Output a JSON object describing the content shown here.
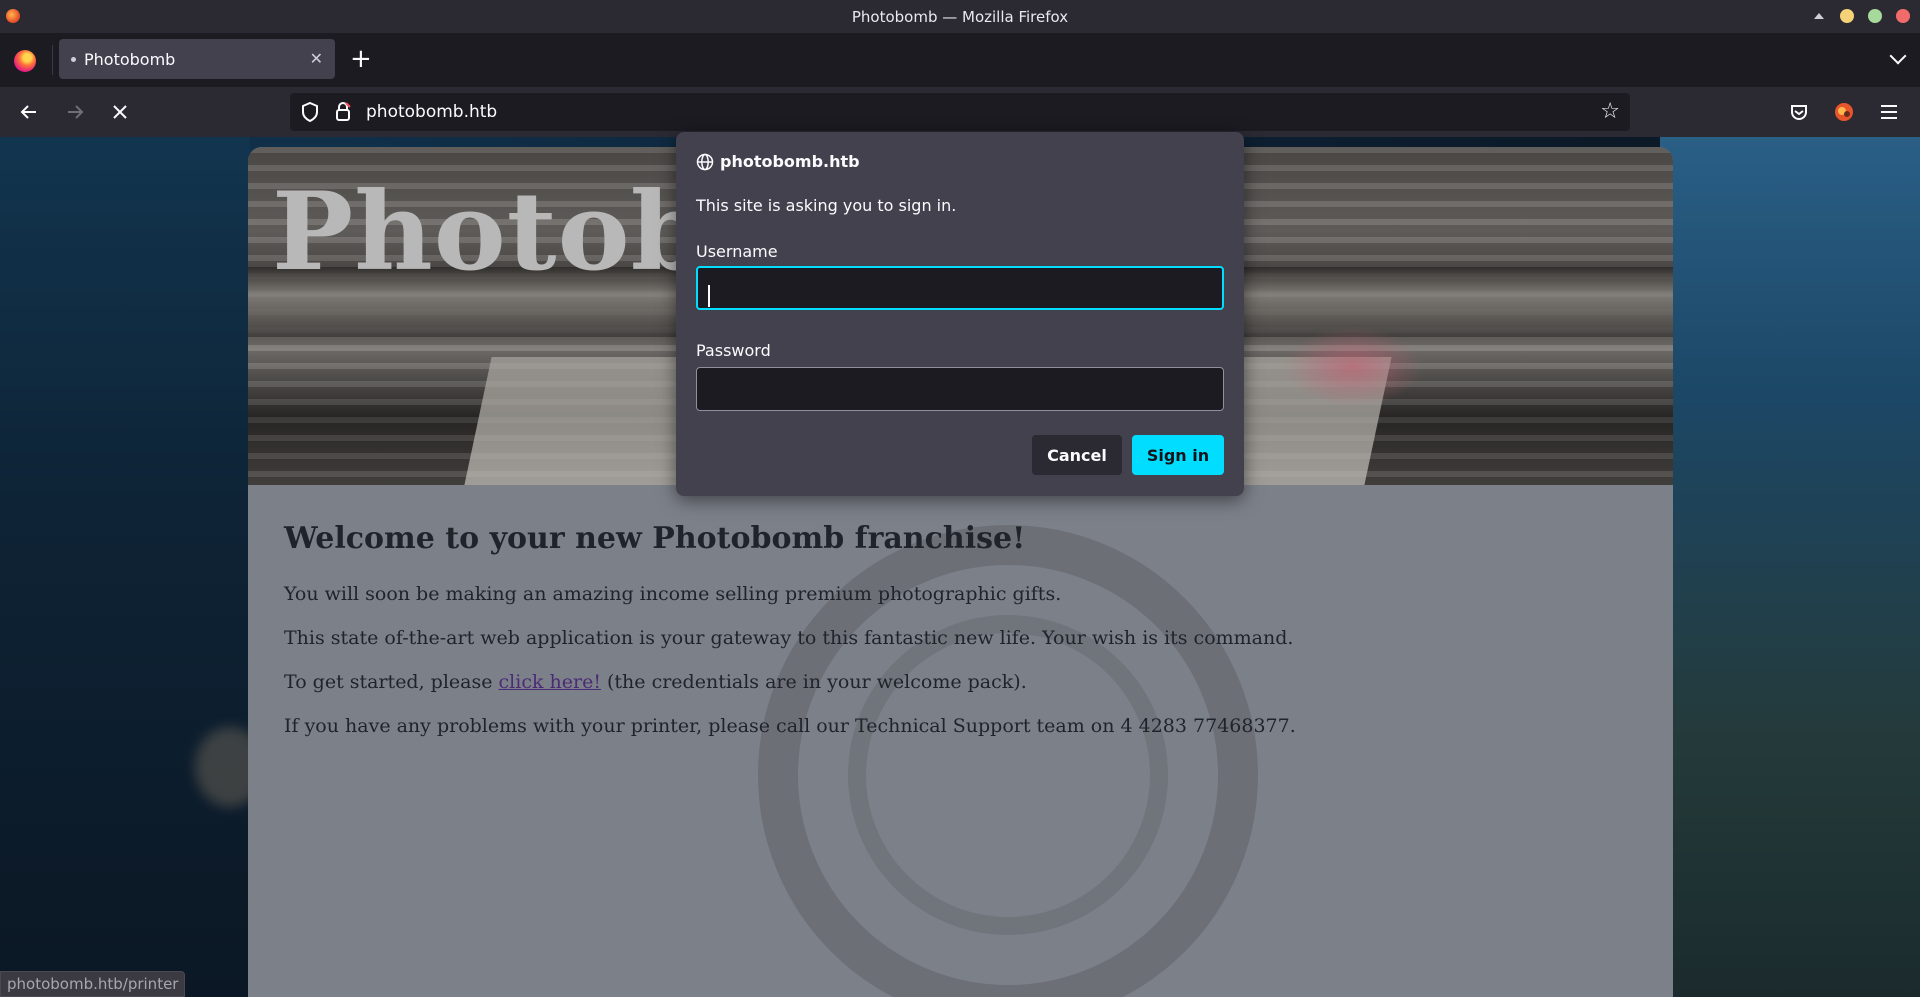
{
  "window": {
    "title": "Photobomb — Mozilla Firefox"
  },
  "tabs": [
    {
      "label": "Photobomb",
      "active": true
    }
  ],
  "navbar": {
    "url": "photobomb.htb"
  },
  "page": {
    "banner_title": "Photob",
    "heading": "Welcome to your new Photobomb franchise!",
    "paragraphs": {
      "p1": "You will soon be making an amazing income selling premium photographic gifts.",
      "p2": "This state of-the-art web application is your gateway to this fantastic new life. Your wish is its command.",
      "p3_before": "To get started, please ",
      "p3_link": "click here!",
      "p3_after": " (the credentials are in your welcome pack).",
      "p4": "If you have any problems with your printer, please call our Technical Support team on 4 4283 77468377."
    }
  },
  "status_bar": {
    "text": "photobomb.htb/printer"
  },
  "auth_dialog": {
    "origin": "photobomb.htb",
    "message": "This site is asking you to sign in.",
    "username_label": "Username",
    "username_value": "",
    "password_label": "Password",
    "password_value": "",
    "cancel_label": "Cancel",
    "signin_label": "Sign in"
  },
  "colors": {
    "accent": "#00ddff",
    "dialog_bg": "#42414d",
    "chrome_bg": "#2b2a33",
    "link": "#4b2a77"
  },
  "icons": {
    "back": "arrow-left-icon",
    "forward": "arrow-right-icon",
    "stop": "close-icon",
    "shield": "shield-icon",
    "lock": "lock-icon",
    "bookmark": "star-icon",
    "pocket": "pocket-icon",
    "account": "account-icon",
    "menu": "hamburger-menu-icon",
    "globe": "globe-icon"
  }
}
